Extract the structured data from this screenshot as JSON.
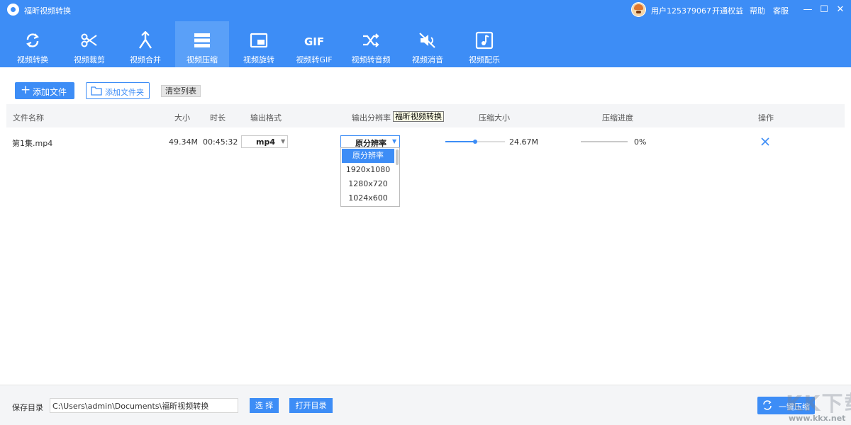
{
  "app": {
    "title": "福昕视频转换"
  },
  "titlebar": {
    "user": "用户125379067",
    "links": [
      "开通权益",
      "帮助",
      "客服"
    ],
    "minimize": "—",
    "maximize": "☐",
    "close": "✕"
  },
  "toolbar": {
    "active_index": 3,
    "items": [
      {
        "label": "视频转换",
        "icon": "rotate-icon"
      },
      {
        "label": "视频裁剪",
        "icon": "scissors-icon"
      },
      {
        "label": "视频合并",
        "icon": "merge-icon"
      },
      {
        "label": "视频压缩",
        "icon": "compress-icon"
      },
      {
        "label": "视频旋转",
        "icon": "rotate-screen-icon"
      },
      {
        "label": "视频转GIF",
        "icon": "gif-icon"
      },
      {
        "label": "视频转音频",
        "icon": "shuffle-icon"
      },
      {
        "label": "视频消音",
        "icon": "mute-icon"
      },
      {
        "label": "视频配乐",
        "icon": "music-icon"
      }
    ]
  },
  "actions": {
    "add_file": "添加文件",
    "add_folder": "添加文件夹",
    "clear_list": "清空列表"
  },
  "table": {
    "headers": {
      "name": "文件名称",
      "size": "大小",
      "duration": "时长",
      "format": "输出格式",
      "resolution": "输出分辨率",
      "compress_size": "压缩大小",
      "progress": "压缩进度",
      "action": "操作"
    },
    "tooltip": "福昕视频转换",
    "rows": [
      {
        "name": "第1集.mp4",
        "size": "49.34M",
        "duration": "00:45:32",
        "format": "mp4",
        "resolution": "原分辨率",
        "compress_ratio": 0.5,
        "compress_size": "24.67M",
        "progress_value": 0,
        "progress": "0%"
      }
    ]
  },
  "resolution_dropdown": {
    "options": [
      "原分辨率",
      "1920x1080",
      "1280x720",
      "1024x600"
    ],
    "selected_index": 0
  },
  "footer": {
    "save_label": "保存目录",
    "path": "C:\\Users\\admin\\Documents\\福昕视频转换",
    "choose": "选 择",
    "open_dir": "打开目录",
    "compress_all": "一键压缩"
  },
  "watermark": {
    "main": "KK下载",
    "sub": "www.kkx.net"
  },
  "colors": {
    "primary": "#3d8df6",
    "active_tab": "#5aa0f8",
    "tooltip_bg": "#ffffe6"
  }
}
